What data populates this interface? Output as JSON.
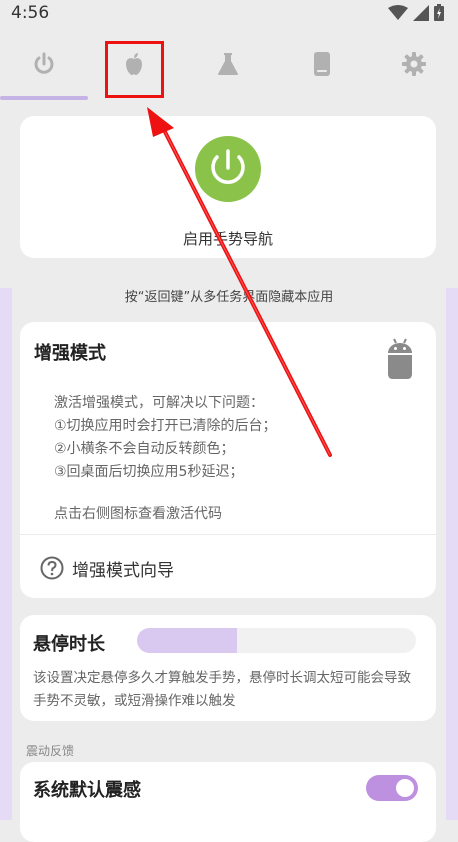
{
  "status_bar": {
    "time": "4:56"
  },
  "tabs": [
    {
      "icon": "power-icon",
      "active": true
    },
    {
      "icon": "apple-icon",
      "active": false,
      "highlighted": true
    },
    {
      "icon": "flask-icon",
      "active": false
    },
    {
      "icon": "phone-icon",
      "active": false
    },
    {
      "icon": "gear-icon",
      "active": false
    }
  ],
  "power_card": {
    "label": "启用手势导航",
    "button_color": "#8bc34a"
  },
  "hint_text": "按“返回键”从多任务界面隐藏本应用",
  "enhanced_card": {
    "title": "增强模式",
    "lines": [
      "激活增强模式，可解决以下问题：",
      "①切换应用时会打开已清除的后台；",
      "②小横条不会自动反转颜色；",
      "③回桌面后切换应用5秒延迟；"
    ],
    "tip": "点击右侧图标查看激活代码",
    "guide_label": "增强模式向导"
  },
  "hover_card": {
    "title": "悬停时长",
    "slider_fraction": 0.36,
    "description": "该设置决定悬停多久才算触发手势，悬停时长调太短可能会导致手势不灵敏，或短滑操作难以触发"
  },
  "vibration": {
    "section_label": "震动反馈",
    "system_default_label": "系统默认震感",
    "toggle_on": true
  },
  "colors": {
    "accent": "#bd91df",
    "arrow": "#e11"
  }
}
